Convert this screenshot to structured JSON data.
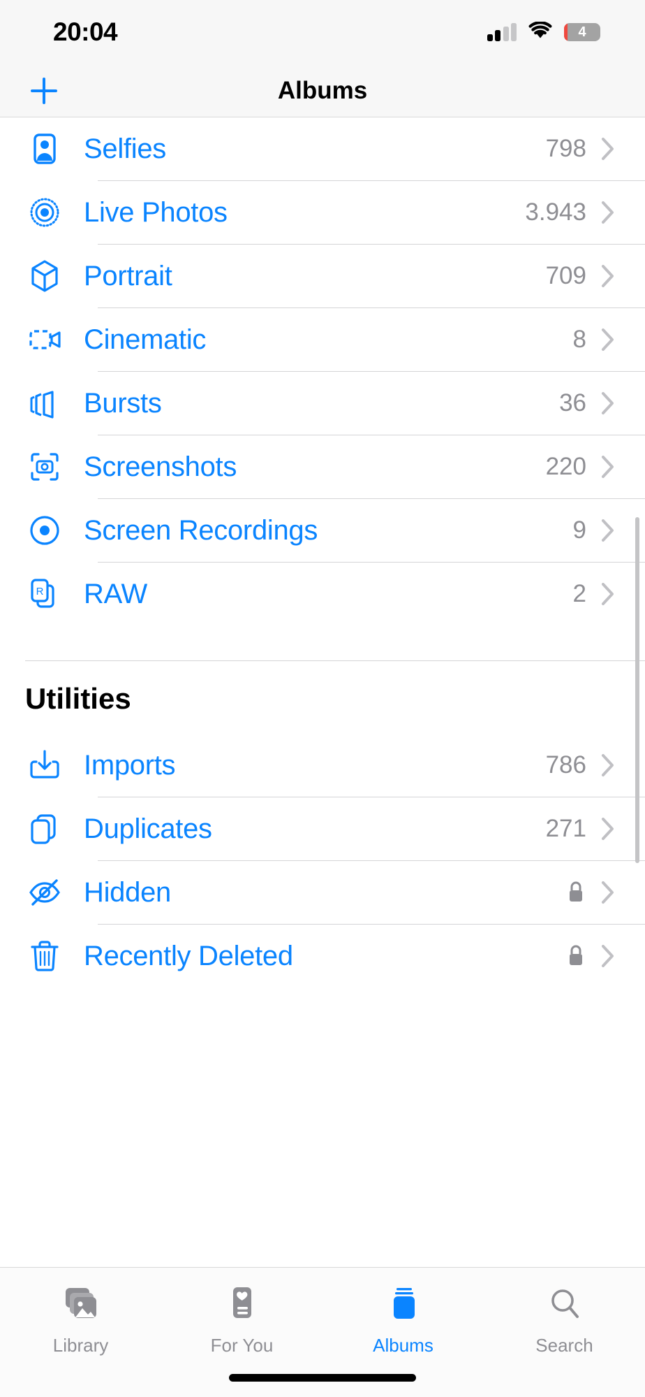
{
  "status_bar": {
    "time": "20:04",
    "battery_level": "4",
    "battery_color": "#f0483e",
    "cellular_bars_filled": 2,
    "cellular_bars_total": 4,
    "wifi_icon": "wifi-icon"
  },
  "nav": {
    "title": "Albums",
    "add_button_icon": "plus-icon"
  },
  "accent_color": "#0a84ff",
  "secondary_text_color": "#8e8e93",
  "media_types": [
    {
      "icon": "selfies-icon",
      "label": "Selfies",
      "count": "798",
      "locked": false
    },
    {
      "icon": "live-photos-icon",
      "label": "Live Photos",
      "count": "3.943",
      "locked": false
    },
    {
      "icon": "portrait-icon",
      "label": "Portrait",
      "count": "709",
      "locked": false
    },
    {
      "icon": "cinematic-icon",
      "label": "Cinematic",
      "count": "8",
      "locked": false
    },
    {
      "icon": "bursts-icon",
      "label": "Bursts",
      "count": "36",
      "locked": false
    },
    {
      "icon": "screenshots-icon",
      "label": "Screenshots",
      "count": "220",
      "locked": false
    },
    {
      "icon": "screen-recordings-icon",
      "label": "Screen Recordings",
      "count": "9",
      "locked": false
    },
    {
      "icon": "raw-icon",
      "label": "RAW",
      "count": "2",
      "locked": false
    }
  ],
  "utilities": {
    "heading": "Utilities",
    "items": [
      {
        "icon": "imports-icon",
        "label": "Imports",
        "count": "786",
        "locked": false
      },
      {
        "icon": "duplicates-icon",
        "label": "Duplicates",
        "count": "271",
        "locked": false
      },
      {
        "icon": "hidden-icon",
        "label": "Hidden",
        "count": "",
        "locked": true
      },
      {
        "icon": "recently-deleted-icon",
        "label": "Recently Deleted",
        "count": "",
        "locked": true
      }
    ]
  },
  "tab_bar": {
    "items": [
      {
        "icon": "library-icon",
        "label": "Library",
        "active": false
      },
      {
        "icon": "for-you-icon",
        "label": "For You",
        "active": false
      },
      {
        "icon": "albums-icon",
        "label": "Albums",
        "active": true
      },
      {
        "icon": "search-icon",
        "label": "Search",
        "active": false
      }
    ]
  }
}
